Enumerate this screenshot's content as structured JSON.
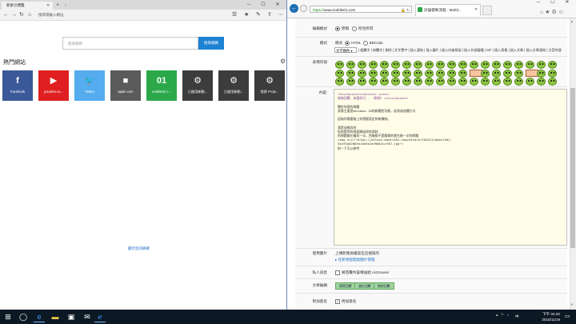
{
  "left_window": {
    "tab_title": "新索引標籤",
    "address_placeholder": "搜尋或輸入網址",
    "search_placeholder": "搜尋網頁",
    "search_button": "搜尋網路",
    "hot_sites_title": "熱門網站",
    "tiles": [
      {
        "label": "Facebook",
        "icon": "f",
        "color": "#3b5998"
      },
      {
        "label": "youtube.co...",
        "icon": "▶",
        "color": "#e02020"
      },
      {
        "label": "Twitter",
        "icon": "🐦",
        "color": "#55acee"
      },
      {
        "label": "apple.com",
        "icon": "",
        "color": "#5a5a5a"
      },
      {
        "label": "mobile01.c...",
        "icon": "01",
        "color": "#2ba84a"
      },
      {
        "label": "已啟用新動...",
        "icon": "⚙",
        "color": "#3c3c3c"
      },
      {
        "label": "已啟用新動...",
        "icon": "⚙",
        "color": "#3c3c3c"
      },
      {
        "label": "首頁 Proje...",
        "icon": "⚙",
        "color": "#3c3c3c"
      }
    ],
    "customize_link": "顯示您的摘要"
  },
  "right_window": {
    "url_prefix": "https://",
    "url_domain": "www.mobile01.",
    "url_rest": "com",
    "tab_title": "討論發佈流程 - Mobil...",
    "form": {
      "row1_label": "編輯模式",
      "row1_opt1": "原稿",
      "row1_opt2": "所見所得",
      "format_label": "模式",
      "format_prefix": "模式",
      "format_opt1": "HTML",
      "format_opt2": "BBCode",
      "format_select": "文字顏色",
      "format_links": "| 粗體字 | 斜體字 | 刪除 | 文字置中 | 插入連結 | 插入圖片 | 插入內嵌框架 | 插入外部圖檔 | GIF | 插入表格 | 插入文章 | 插入文章連結 | 注音符號",
      "emoji_label": "表情符號",
      "content_label": "內容:",
      "content_lines": [
        "<blockquote>nsXXXuser wrote:",
        "感謝回覆，恭喜你可...（刪除）</blockquote>",
        "",
        "關於你提的問題",
        "其實主要是Windows 10的新觸控功能，從改成這種方式",
        "",
        "因為你需要裝上你想要設定的新機制。",
        "",
        "我是這樣弄的",
        "從前提到的版面開始與你測試",
        "的問題會在最初一半，然後都不是簡單的就先做一半的問題",
        "<img src=\"https://attach.mobile01.com/attach/201511/mobile01-",
        "5e4f5ad208fb1ae5e2af68e2ccf87.jpg\">",
        "附一下可以參考"
      ],
      "attach_label": "使用圖片",
      "attach_text": "上傳影像與檔案在這裡操作",
      "attach_link": "▸ 在新視窗開啟圖片管理",
      "sig_label": "私人訊息",
      "sig_text": "將回覆內容傳送給 ns315user",
      "btn_label": "文章編輯",
      "btn1": "預覽回覆",
      "btn2": "儲存回覆",
      "btn3": "刪除回覆",
      "last_label": "附加簽名",
      "last_text": "附加簽名"
    }
  },
  "taskbar": {
    "time": "下午 04:20",
    "date": "2015/11/19",
    "lang": "中"
  }
}
